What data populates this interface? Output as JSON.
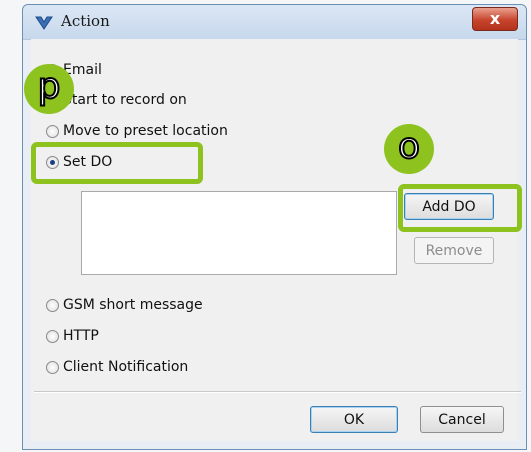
{
  "window": {
    "title": "Action",
    "close_glyph": "x"
  },
  "options": {
    "email": "Email",
    "record": "Start to record on",
    "preset": "Move to preset location",
    "set_do": "Set DO",
    "gsm": "GSM short message",
    "http": "HTTP",
    "client_notification": "Client Notification"
  },
  "selected_option": "set_do",
  "buttons": {
    "add_do": "Add DO",
    "remove": "Remove",
    "ok": "OK",
    "cancel": "Cancel"
  },
  "annotations": {
    "p": "p",
    "o": "o"
  },
  "colors": {
    "highlight": "#8dc21f",
    "title_bar": "#c7d8ec",
    "close_button": "#c8442c"
  }
}
